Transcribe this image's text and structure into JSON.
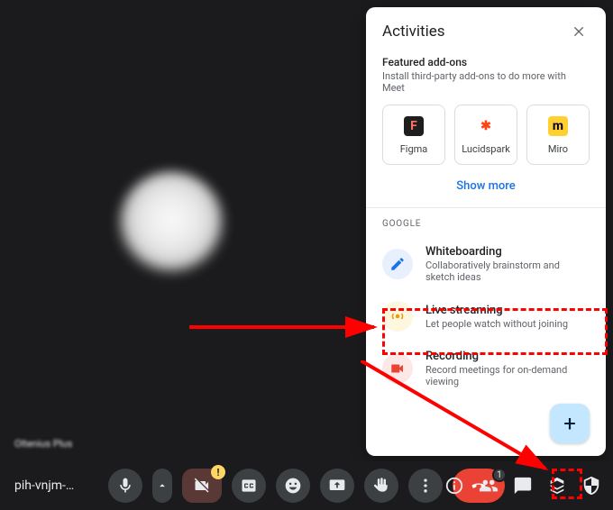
{
  "meeting": {
    "code_short": "pih-vnjm-…",
    "participant_name": "Oltenius Plus"
  },
  "bottom_icons": {
    "mic": "mic-icon",
    "mic_chevron": "chevron-up-icon",
    "camera_off": "camera-off-icon",
    "captions": "captions-icon",
    "emoji": "emoji-icon",
    "present": "present-icon",
    "hand": "raise-hand-icon",
    "more": "more-icon",
    "end": "end-call-icon",
    "info": "info-icon",
    "people": "people-icon",
    "people_count": "1",
    "chat": "chat-icon",
    "activities": "activities-icon",
    "host": "host-controls-icon"
  },
  "panel": {
    "title": "Activities",
    "featured": {
      "title": "Featured add-ons",
      "subtitle": "Install third-party add-ons to do more with Meet",
      "items": [
        {
          "label": "Figma",
          "icon_bg": "#1e1e1e",
          "icon_fg": "#ff7262",
          "glyph": "F"
        },
        {
          "label": "Lucidspark",
          "icon_bg": "#ffffff",
          "icon_fg": "#fa4616",
          "glyph": "✱"
        },
        {
          "label": "Miro",
          "icon_bg": "#ffd02f",
          "icon_fg": "#050038",
          "glyph": "m"
        }
      ],
      "show_more": "Show more"
    },
    "google_label": "GOOGLE",
    "activities": [
      {
        "key": "whiteboarding",
        "title": "Whiteboarding",
        "subtitle": "Collaboratively brainstorm and sketch ideas"
      },
      {
        "key": "live-streaming",
        "title": "Live streaming",
        "subtitle": "Let people watch without joining"
      },
      {
        "key": "recording",
        "title": "Recording",
        "subtitle": "Record meetings for on-demand viewing"
      }
    ],
    "fab_label": "+"
  }
}
